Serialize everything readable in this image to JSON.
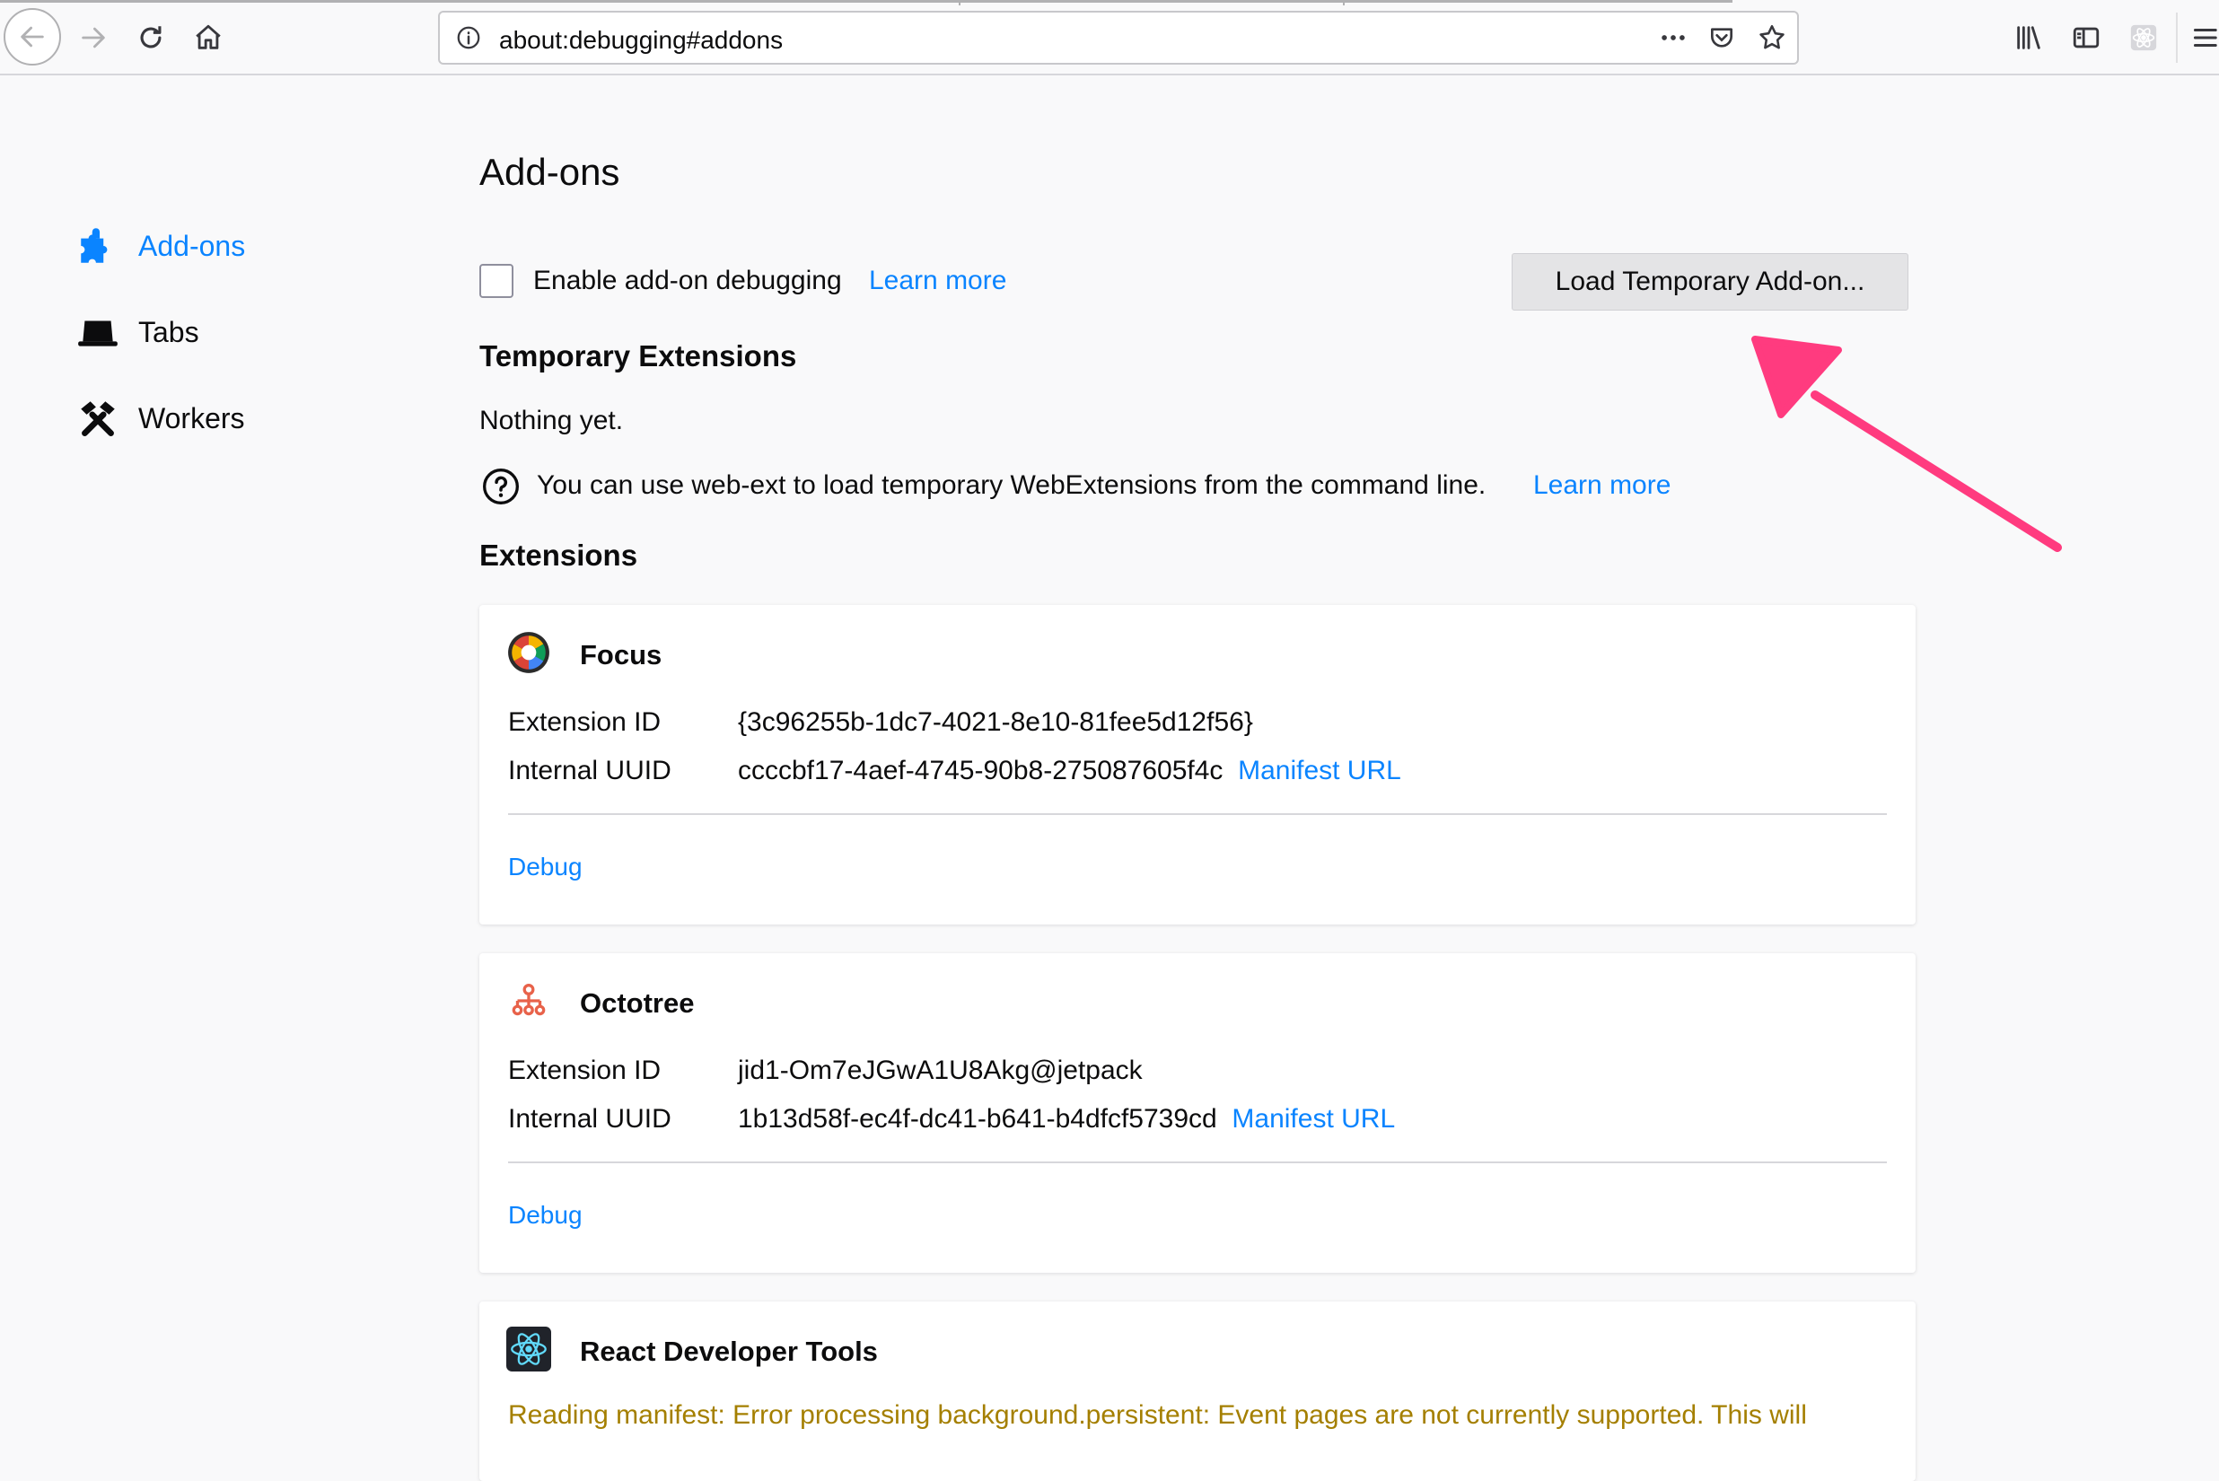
{
  "browser": {
    "url": "about:debugging#addons",
    "icons": [
      "back-icon",
      "forward-icon",
      "reload-icon",
      "home-icon",
      "info-icon",
      "page-actions-icon",
      "pocket-icon",
      "bookmark-star-icon",
      "library-icon",
      "sidebar-icon",
      "extension-icon",
      "menu-icon"
    ]
  },
  "sidebar": {
    "items": [
      {
        "label": "Add-ons",
        "icon": "puzzle-icon",
        "active": true
      },
      {
        "label": "Tabs",
        "icon": "tab-icon",
        "active": false
      },
      {
        "label": "Workers",
        "icon": "tools-icon",
        "active": false
      }
    ]
  },
  "main": {
    "title": "Add-ons",
    "enable_debugging_label": "Enable add-on debugging",
    "learn_more": "Learn more",
    "load_button": "Load Temporary Add-on...",
    "temporary_heading": "Temporary Extensions",
    "nothing_yet": "Nothing yet.",
    "webext_tip": "You can use web-ext to load temporary WebExtensions from the command line.",
    "extensions_heading": "Extensions"
  },
  "extensions": [
    {
      "name": "Focus",
      "id_label": "Extension ID",
      "id": "{3c96255b-1dc7-4021-8e10-81fee5d12f56}",
      "uuid_label": "Internal UUID",
      "uuid": "ccccbf17-4aef-4745-90b8-275087605f4c",
      "manifest": "Manifest URL",
      "debug": "Debug"
    },
    {
      "name": "Octotree",
      "id_label": "Extension ID",
      "id": "jid1-Om7eJGwA1U8Akg@jetpack",
      "uuid_label": "Internal UUID",
      "uuid": "1b13d58f-ec4f-dc41-b641-b4dfcf5739cd",
      "manifest": "Manifest URL",
      "debug": "Debug"
    },
    {
      "name": "React Developer Tools",
      "warning": "Reading manifest: Error processing background.persistent: Event pages are not currently supported. This will"
    }
  ],
  "colors": {
    "link": "#0a84ff",
    "warning": "#a47f00",
    "annotation_arrow": "#ff3b7f"
  }
}
